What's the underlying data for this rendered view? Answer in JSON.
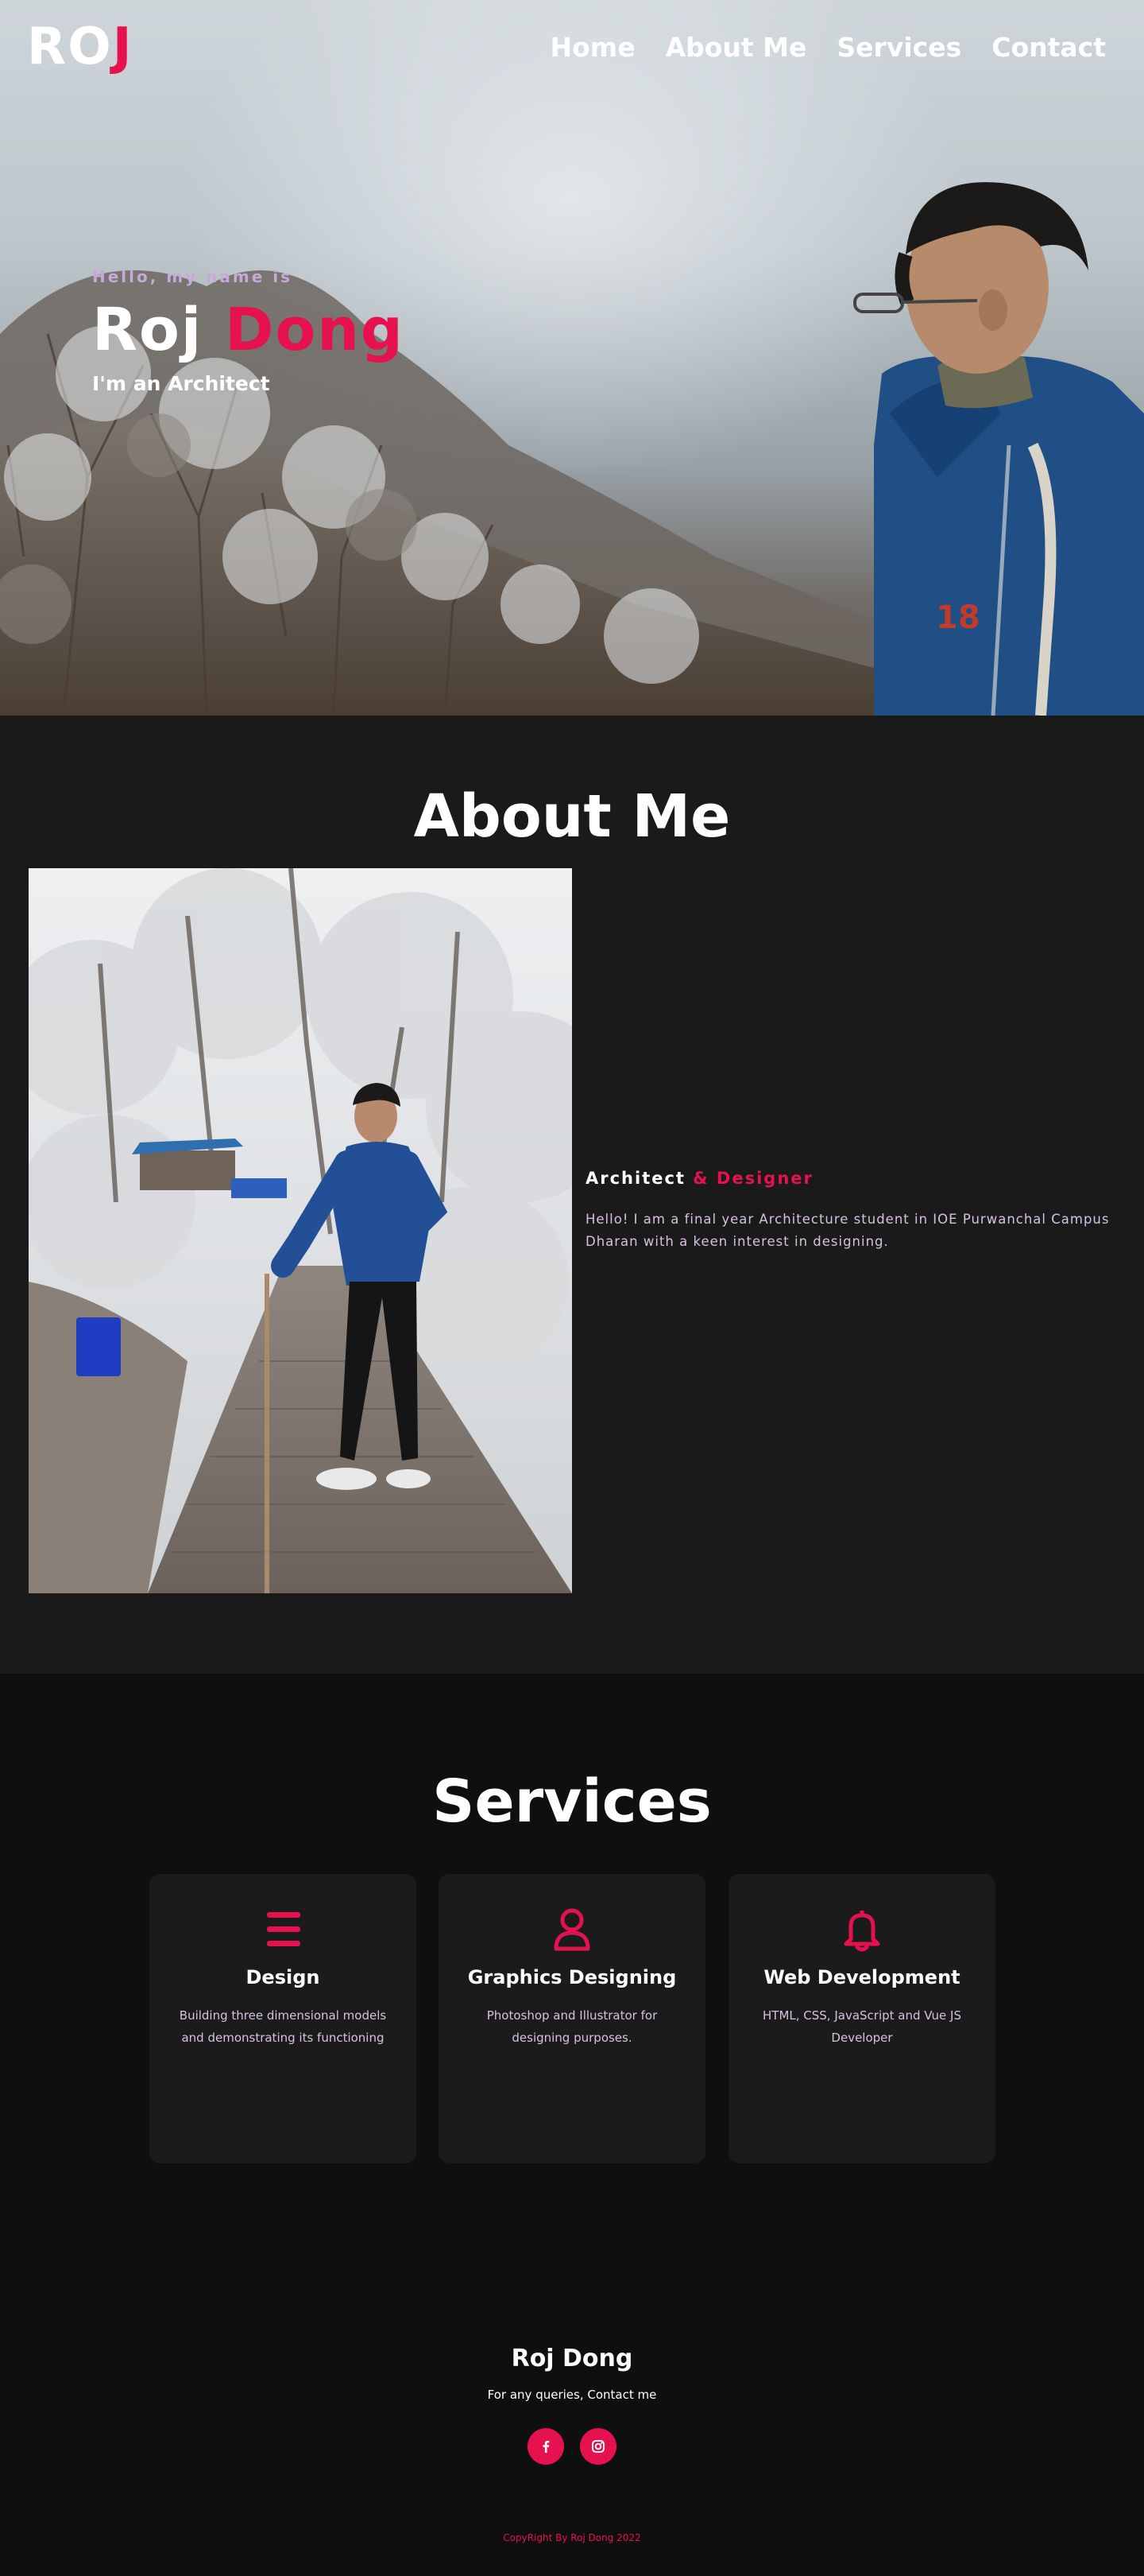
{
  "nav": {
    "logo_main": "RO",
    "logo_accent": "J",
    "links": [
      "Home",
      "About Me",
      "Services",
      "Contact"
    ]
  },
  "hero": {
    "greeting": "Hello, my name is",
    "first_name": "Roj",
    "last_name": "Dong",
    "subtitle": "I'm an Architect"
  },
  "about": {
    "title": "About Me",
    "heading_main": "Architect",
    "heading_accent": "& Designer",
    "text": "Hello! I am a final year Architecture student in IOE Purwanchal Campus Dharan with a keen interest in designing."
  },
  "services": {
    "title": "Services",
    "cards": [
      {
        "icon": "menu-bars-icon",
        "title": "Design",
        "text": "Building three dimensional models and demonstrating its functioning"
      },
      {
        "icon": "user-icon",
        "title": "Graphics Designing",
        "text": "Photoshop and Illustrator for designing purposes."
      },
      {
        "icon": "bell-icon",
        "title": "Web Development",
        "text": "HTML, CSS, JavaScript and Vue JS Developer"
      }
    ]
  },
  "footer": {
    "name": "Roj Dong",
    "subtitle": "For any queries, Contact me",
    "socials": [
      "facebook-icon",
      "instagram-icon"
    ],
    "copyright": "CopyRight By Roj Dong 2022"
  },
  "colors": {
    "accent": "#e5124f",
    "section_dark": "#1a1a1a",
    "page_bg": "#0f0f0f",
    "muted_text": "#d8c0e0"
  }
}
